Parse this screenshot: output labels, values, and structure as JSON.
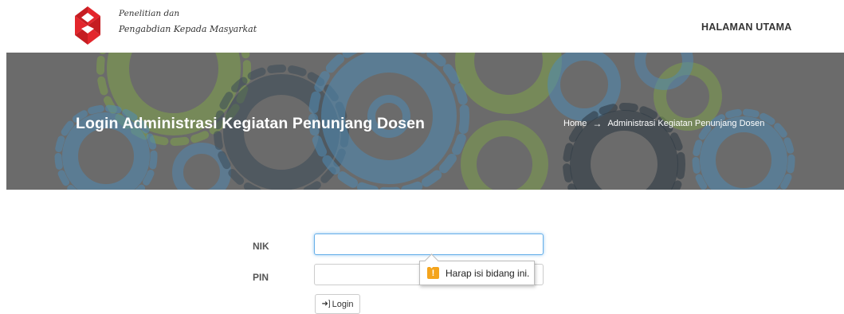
{
  "header": {
    "brand_line1": "Penelitian dan",
    "brand_line2": "Pengabdian Kepada Masyarkat",
    "nav_home": "HALAMAN UTAMA"
  },
  "banner": {
    "title": "Login Administrasi Kegiatan Penunjang Dosen",
    "breadcrumb": {
      "home": "Home",
      "separator": "→",
      "current": "Administrasi Kegiatan Penunjang Dosen"
    }
  },
  "form": {
    "nik_label": "NIK",
    "nik_value": "",
    "pin_label": "PIN",
    "pin_value": "",
    "login_label": "Login",
    "login_icon": "sign-in-icon"
  },
  "tooltip": {
    "icon": "warning-icon",
    "text": "Harap isi bidang ini."
  },
  "colors": {
    "logo_red": "#e3262c",
    "banner_overlay": "#6b6b6b",
    "focus_blue": "#66afe9",
    "warning_orange": "#f4a41c"
  }
}
